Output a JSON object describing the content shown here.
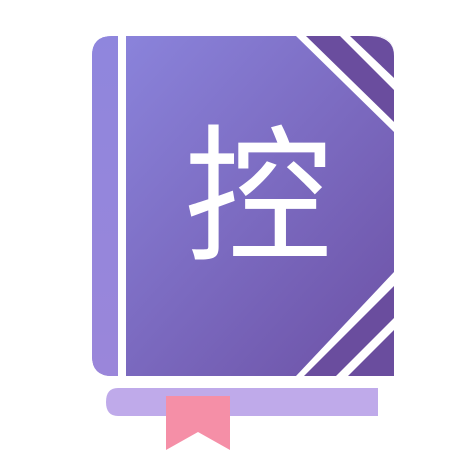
{
  "app_icon": {
    "glyph": "控",
    "icon_name": "book-icon",
    "bookmark_icon_name": "bookmark-ribbon-icon"
  },
  "colors": {
    "cover_gradient_top": "#8a84dc",
    "cover_gradient_bottom": "#6d54a8",
    "spine": "#9287df",
    "corner_stripe": "#6a4d9e",
    "bookmark": "#f58fa7",
    "pages": "#b9a6e8",
    "outline": "#ffffff"
  }
}
